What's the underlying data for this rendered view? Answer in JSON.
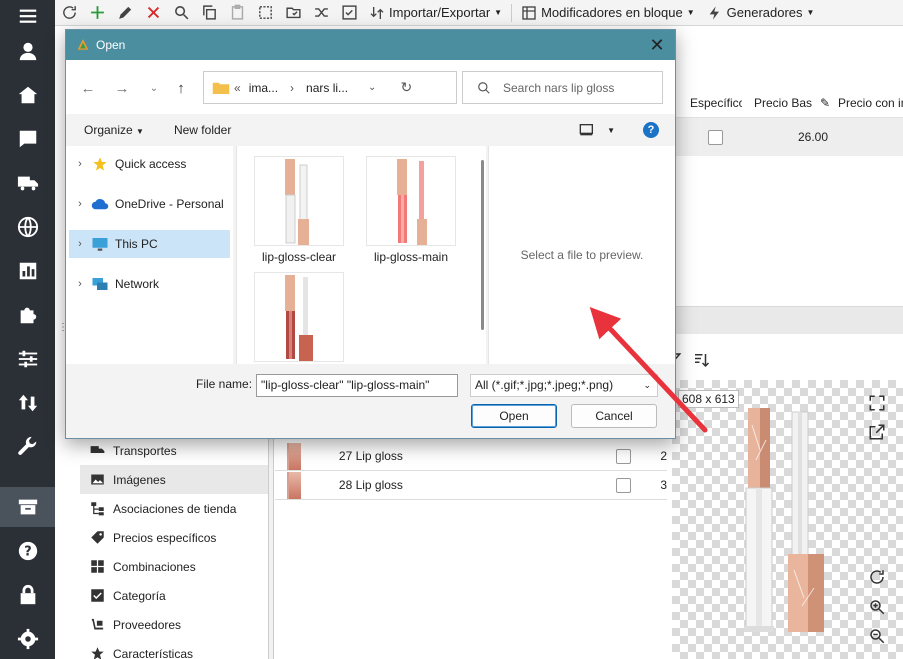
{
  "toolbar": {
    "import_export": "Importar/Exportar",
    "bulk_modifiers": "Modificadores en bloque",
    "generators": "Generadores"
  },
  "sidebar_icons": [
    "menu-icon",
    "user-icon",
    "home-icon",
    "chat-icon",
    "truck-icon",
    "globe-icon",
    "chart-icon",
    "puzzle-icon",
    "sliders-icon",
    "sort-icon",
    "wrench-icon",
    "store-icon",
    "help-icon",
    "lock-icon",
    "settings-icon"
  ],
  "product_table": {
    "col_especifico": "Específico",
    "col_precio_base": "Precio Bas",
    "col_precio_con": "Precio con im",
    "row_price": "26.00"
  },
  "image_preview": {
    "dimensions": "608 x 613"
  },
  "subnav": {
    "items": [
      "Transportes",
      "Imágenes",
      "Asociaciones de tienda",
      "Precios específicos",
      "Combinaciones",
      "Categoría",
      "Proveedores",
      "Características"
    ]
  },
  "image_list": {
    "rows": [
      {
        "name": "27 Lip gloss",
        "num": "2"
      },
      {
        "name": "28 Lip gloss",
        "num": "3"
      }
    ]
  },
  "dialog": {
    "title": "Open",
    "address": {
      "prefix": "«",
      "seg1": "ima...",
      "sep": "›",
      "seg2": "nars li..."
    },
    "search_placeholder": "Search nars lip gloss",
    "organize": "Organize",
    "new_folder": "New folder",
    "tree": [
      "Quick access",
      "OneDrive - Personal",
      "This PC",
      "Network"
    ],
    "files": [
      "lip-gloss-clear",
      "lip-gloss-main",
      ""
    ],
    "preview_text": "Select a file to preview.",
    "file_name_label": "File name:",
    "file_name_value": "\"lip-gloss-clear\" \"lip-gloss-main\"",
    "file_type": "All (*.gif;*.jpg;*.jpeg;*.png)",
    "open_button": "Open",
    "cancel_button": "Cancel"
  },
  "colors": {
    "sidebar": "#2b2f36",
    "dialog_title": "#4a8ea0",
    "arrow": "#e8323c",
    "selection": "#cce4f7"
  }
}
